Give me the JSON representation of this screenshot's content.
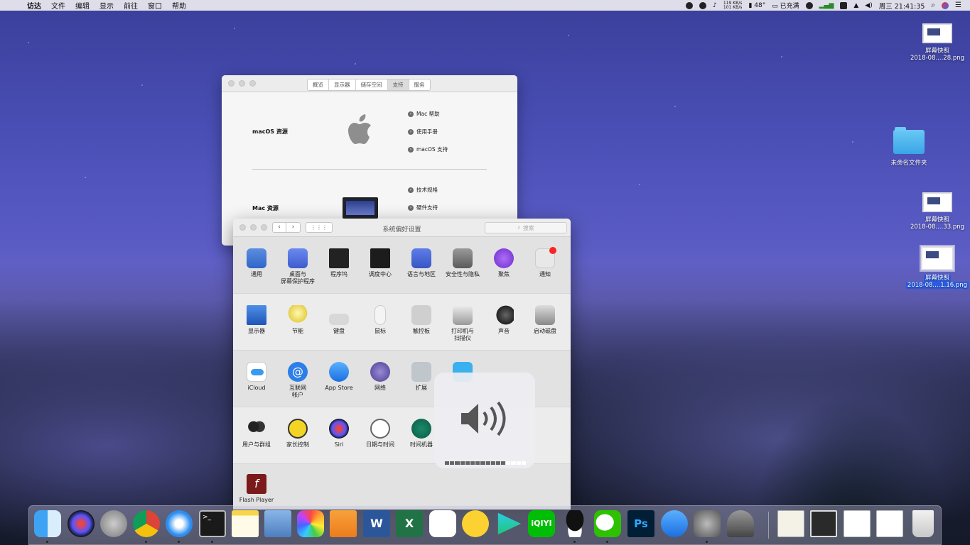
{
  "menubar": {
    "items": [
      "访达",
      "文件",
      "编辑",
      "显示",
      "前往",
      "窗口",
      "帮助"
    ],
    "net_up": "119 KB/s",
    "net_down": "101 KB/s",
    "temp": "48°",
    "battery": "已充满",
    "clock": "周三 21:41:35"
  },
  "desktop": {
    "icons": [
      {
        "name": "屏幕快照",
        "sub": "2018-08....28.png"
      },
      {
        "name": "未命名文件夹",
        "sub": ""
      },
      {
        "name": "屏幕快照",
        "sub": "2018-08....33.png"
      },
      {
        "name": "屏幕快照",
        "sub": "2018-08....1.16.png"
      }
    ]
  },
  "about": {
    "tabs": [
      "概览",
      "显示器",
      "储存空间",
      "支持",
      "服务"
    ],
    "active_tab": "支持",
    "macos_resources": "macOS 资源",
    "mac_resources": "Mac 资源",
    "links": [
      "Mac 帮助",
      "使用手册",
      "macOS 支持",
      "技术规格",
      "硬件支持"
    ]
  },
  "prefs": {
    "title": "系统偏好设置",
    "search_placeholder": "搜索",
    "row1": [
      "通用",
      "桌面与\n屏幕保护程序",
      "程序坞",
      "调度中心",
      "语言与地区",
      "安全性与隐私",
      "聚焦",
      "通知"
    ],
    "row2": [
      "显示器",
      "节能",
      "键盘",
      "鼠标",
      "触控板",
      "打印机与\n扫描仪",
      "声音",
      "启动磁盘"
    ],
    "row3": [
      "iCloud",
      "互联网\n帐户",
      "App Store",
      "网络",
      "扩展",
      ""
    ],
    "row4": [
      "用户与群组",
      "家长控制",
      "Siri",
      "日期与时间",
      "时间机器"
    ],
    "row5": [
      "Flash Player"
    ]
  },
  "volume": {
    "level_steps": 16,
    "filled": 12
  },
  "dock": {
    "apps": [
      "Finder",
      "Siri",
      "Launchpad",
      "Chrome",
      "Safari",
      "Terminal",
      "Notes",
      "Preview",
      "Photos",
      "Pages",
      "Word",
      "Excel",
      "Baidu Netdisk",
      "QQ Music",
      "Video",
      "iQIYI",
      "QQ",
      "WeChat",
      "Photoshop",
      "App Store",
      "System Preferences",
      "Utility"
    ],
    "stacks": [
      "Certificate",
      "Screenshot",
      "Screenshot",
      "Screenshot",
      "Trash"
    ]
  }
}
